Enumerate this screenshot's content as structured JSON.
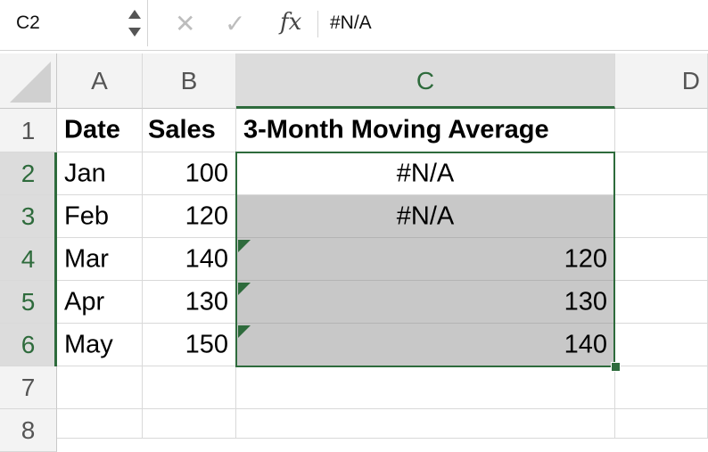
{
  "formula_bar": {
    "name_box": "C2",
    "cancel_icon": "✕",
    "confirm_icon": "✓",
    "fx_label": "fx",
    "formula": "#N/A"
  },
  "columns": [
    "A",
    "B",
    "C",
    "D"
  ],
  "rows": [
    "1",
    "2",
    "3",
    "4",
    "5",
    "6",
    "7",
    "8"
  ],
  "cells": {
    "A1": "Date",
    "B1": "Sales",
    "C1": "3-Month Moving Average",
    "A2": "Jan",
    "B2": "100",
    "C2": "#N/A",
    "A3": "Feb",
    "B3": "120",
    "C3": "#N/A",
    "A4": "Mar",
    "B4": "140",
    "C4": "120",
    "A5": "Apr",
    "B5": "130",
    "C5": "130",
    "A6": "May",
    "B6": "150",
    "C6": "140"
  },
  "colors": {
    "selection_accent": "#2e6b3c",
    "selection_fill": "#c8c8c8"
  }
}
